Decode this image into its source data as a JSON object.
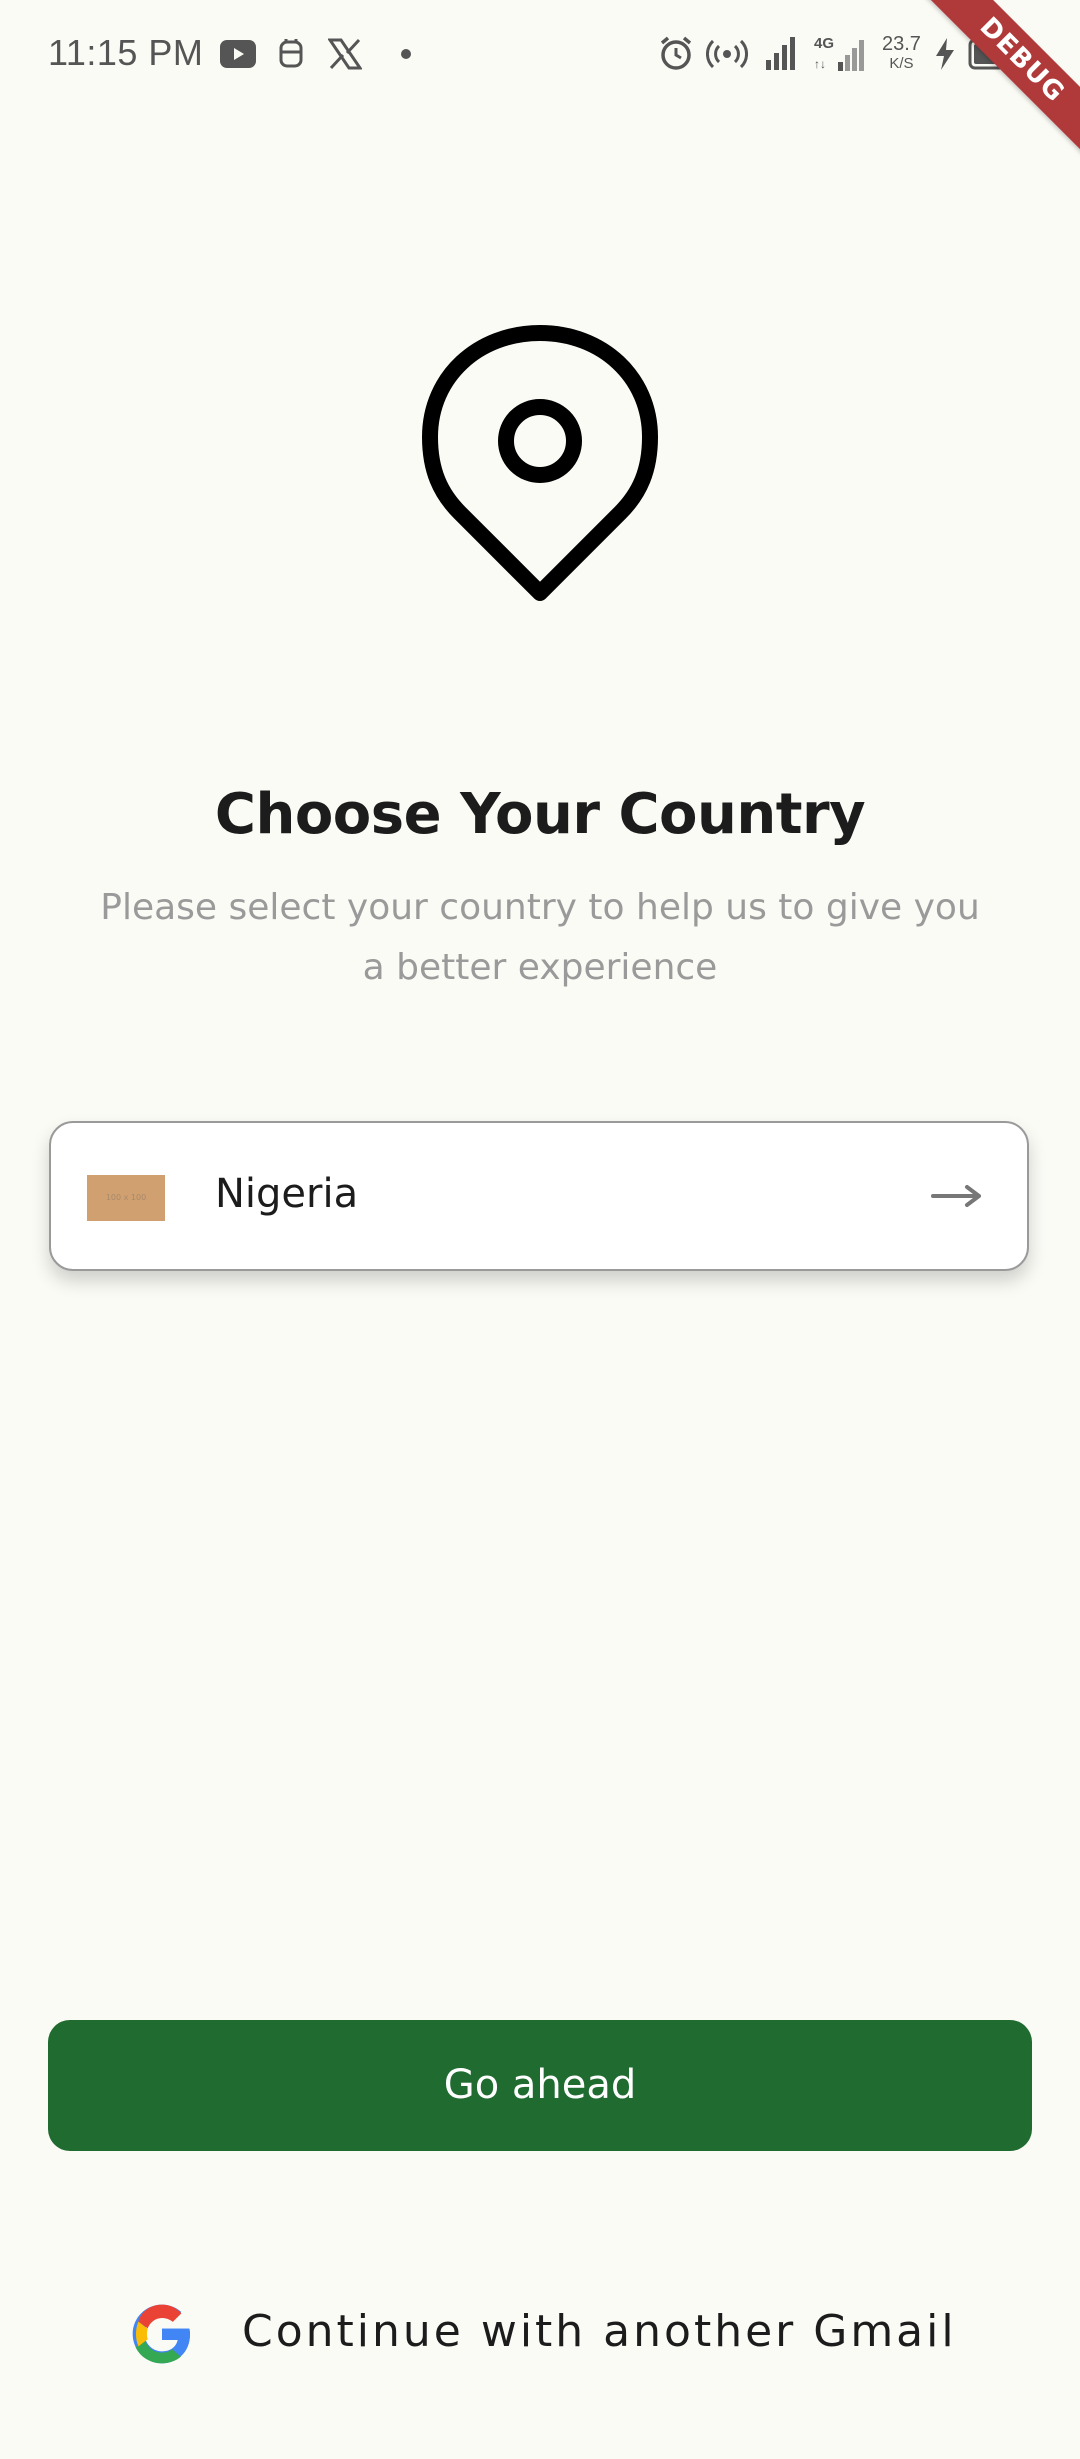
{
  "status_bar": {
    "time": "11:15 PM",
    "net_speed_value": "23.7",
    "net_speed_unit": "K/S",
    "network_type": "4G"
  },
  "debug_banner": {
    "label": "DEBUG"
  },
  "header": {
    "title": "Choose Your Country",
    "subtitle": "Please select your country to help us to give you a better experience"
  },
  "country_selector": {
    "selected_country": "Nigeria",
    "flag_placeholder_text": "100 x 100"
  },
  "actions": {
    "primary_label": "Go ahead",
    "google_label": "Continue with another Gmail"
  },
  "colors": {
    "background": "#fbfbf6",
    "primary_button": "#1f6b30",
    "subtitle_text": "#9a9a9a",
    "debug_banner": "#b03a3a"
  }
}
